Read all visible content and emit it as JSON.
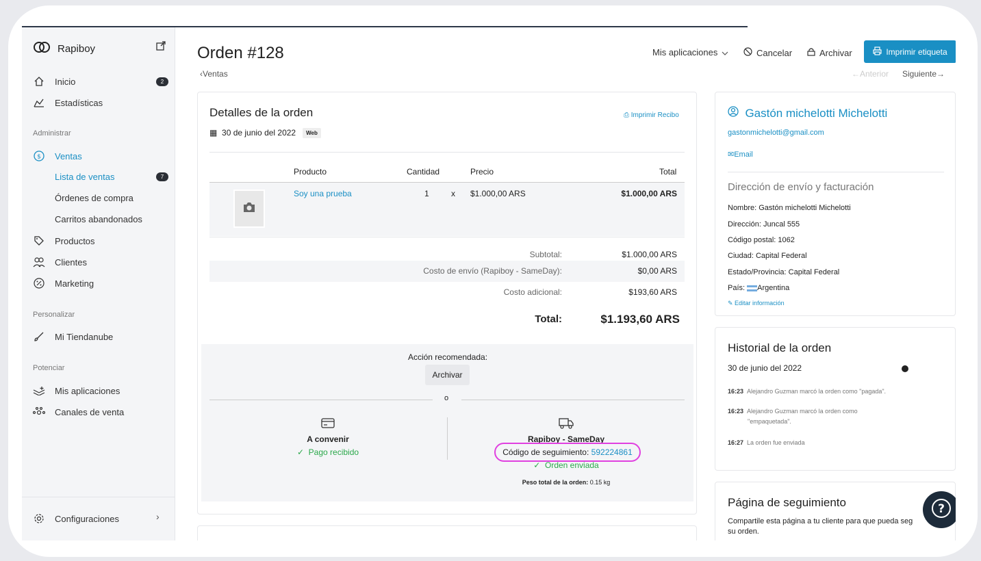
{
  "sidebar": {
    "brand": "Rapiboy",
    "items": [
      {
        "label": "Inicio",
        "badge": "2"
      },
      {
        "label": "Estadísticas"
      }
    ],
    "section_admin": "Administrar",
    "ventas_label": "Ventas",
    "sub_items": [
      {
        "label": "Lista de ventas",
        "badge": "7"
      },
      {
        "label": "Órdenes de compra"
      },
      {
        "label": "Carritos abandonados"
      }
    ],
    "admin_items": [
      {
        "label": "Productos"
      },
      {
        "label": "Clientes"
      },
      {
        "label": "Marketing"
      }
    ],
    "section_personalizar": "Personalizar",
    "mi_tiendanube": "Mi Tiendanube",
    "section_potenciar": "Potenciar",
    "mis_aplicaciones": "Mis aplicaciones",
    "canales": "Canales de venta",
    "configuraciones": "Configuraciones"
  },
  "header": {
    "title": "Orden #128",
    "apps": "Mis aplicaciones",
    "cancel": "Cancelar",
    "archive": "Archivar",
    "print_label": "Imprimir etiqueta",
    "breadcrumb": "Ventas",
    "prev": "Anterior",
    "next": "Siguiente"
  },
  "order": {
    "title": "Detalles de la orden",
    "print_receipt": "Imprimir Recibo",
    "date": "30 de junio del 2022",
    "channel": "Web",
    "columns": [
      "Producto",
      "Cantidad",
      "Precio",
      "Total"
    ],
    "item": {
      "name": "Soy una prueba",
      "qty": "1",
      "x": "x",
      "price": "$1.000,00 ARS",
      "total": "$1.000,00 ARS"
    },
    "subtotal_label": "Subtotal:",
    "subtotal": "$1.000,00 ARS",
    "shipping_label": "Costo de envío (Rapiboy - SameDay):",
    "shipping": "$0,00 ARS",
    "extra_label": "Costo adicional:",
    "extra": "$193,60 ARS",
    "total_label": "Total:",
    "total": "$1.193,60 ARS",
    "action_label": "Acción recomendada:",
    "action_button": "Archivar",
    "or": "o",
    "payment_title": "A convenir",
    "payment_status": "Pago recibido",
    "shipping_title": "Rapiboy - SameDay",
    "tracking_label": "Código de seguimiento:",
    "tracking_code": "592224861",
    "shipping_status": "Orden enviada",
    "weight_label": "Peso total de la orden:",
    "weight": "0.15 kg"
  },
  "customer": {
    "name": "Gastón michelotti Michelotti",
    "email": "gastonmichelotti@gmail.com",
    "email_link": "Email",
    "address_title": "Dirección de envío y facturación",
    "lines": [
      "Nombre: Gastón michelotti Michelotti",
      "Dirección: Juncal 555",
      "Código postal: 1062",
      "Ciudad: Capital Federal",
      "Estado/Provincia: Capital Federal"
    ],
    "country_label": "País:",
    "country": "Argentina",
    "edit": "Editar información"
  },
  "history": {
    "title": "Historial de la orden",
    "date": "30 de junio del 2022",
    "events": [
      {
        "time": "16:23",
        "text": "Alejandro Guzman marcó la orden como \"pagada\"."
      },
      {
        "time": "16:23",
        "text": "Alejandro Guzman marcó la orden como",
        "text2": "\"empaquetada\"."
      },
      {
        "time": "16:27",
        "text": "La orden fue enviada"
      }
    ]
  },
  "tracking_page": {
    "title": "Página de seguimiento",
    "line1": "Compartile esta página a tu cliente para que pueda seg",
    "line2": "su orden."
  },
  "colors": {
    "accent": "#1a8fc4",
    "highlight": "#e040e0",
    "success": "#2aa84a"
  }
}
